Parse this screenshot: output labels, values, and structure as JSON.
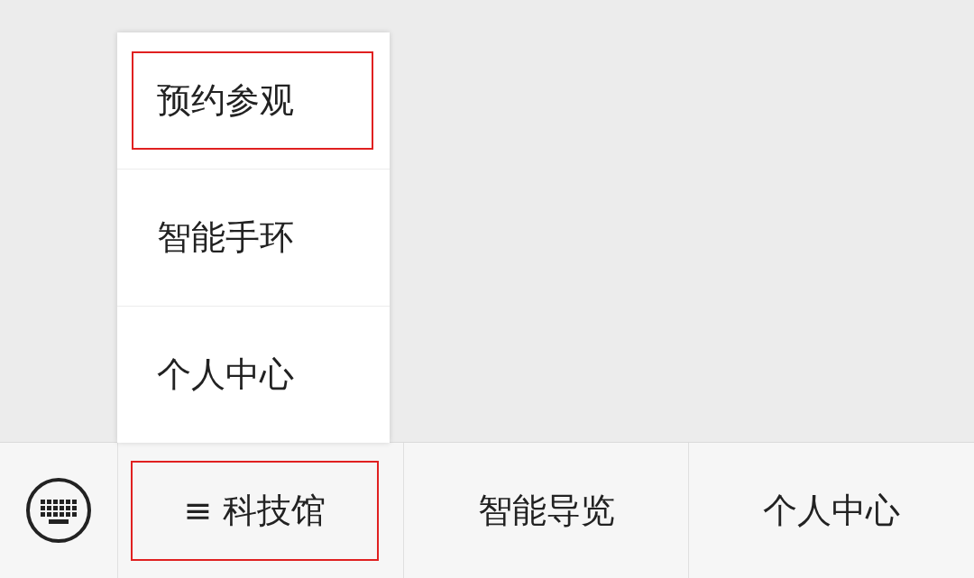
{
  "popup_menu": {
    "items": [
      {
        "label": "预约参观",
        "highlighted": true
      },
      {
        "label": "智能手环",
        "highlighted": false
      },
      {
        "label": "个人中心",
        "highlighted": false
      }
    ]
  },
  "bottom_menu": {
    "items": [
      {
        "icon": "≡",
        "label": "科技馆",
        "highlighted": true,
        "expanded": true
      },
      {
        "label": "智能导览",
        "highlighted": false,
        "expanded": false
      },
      {
        "label": "个人中心",
        "highlighted": false,
        "expanded": false
      }
    ]
  }
}
